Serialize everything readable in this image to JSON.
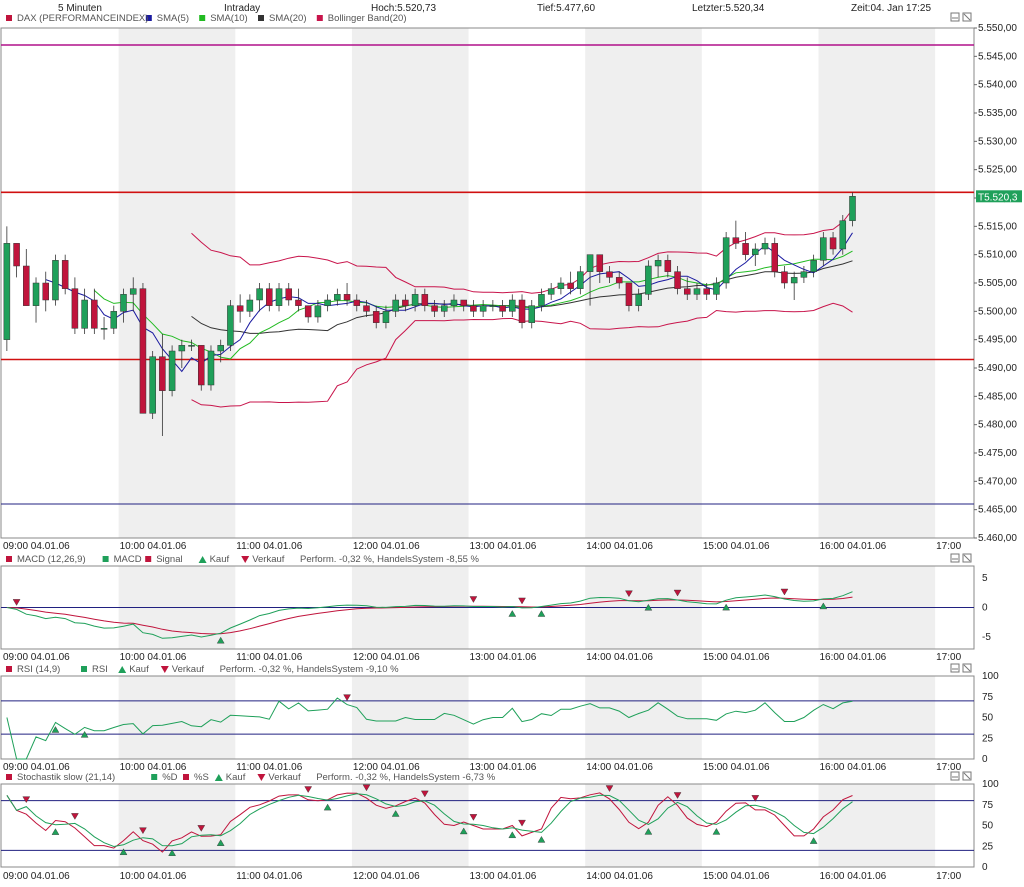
{
  "header": {
    "interval": "5 Minuten",
    "mode": "Intraday",
    "high": "Hoch:5.520,73",
    "low": "Tief:5.477,60",
    "last": "Letzter:5.520,34",
    "time": "Zeit:04. Jan 17:25"
  },
  "colors": {
    "up": "#1fa05a",
    "down": "#c0143c",
    "sma5": "#1a1aa0",
    "sma10": "#22bb22",
    "sma20": "#333333",
    "boll": "#c8144b",
    "redline": "#d01010",
    "magline": "#b0108a",
    "blueline": "#202080",
    "band": "#efefef",
    "border": "#888888",
    "tag": "#1fa05a"
  },
  "panels": [
    {
      "id": "price",
      "legend": [
        {
          "text": "DAX (PERFORMANCEINDEX)",
          "color": "#c0143c"
        },
        {
          "text": "SMA(5)",
          "color": "#1a1aa0"
        },
        {
          "text": "SMA(10)",
          "color": "#22bb22"
        },
        {
          "text": "SMA(20)",
          "color": "#333333"
        },
        {
          "text": "Bollinger Band(20)",
          "color": "#c8144b"
        }
      ],
      "yticks": [
        "5.550,00",
        "5.545,00",
        "5.540,00",
        "5.535,00",
        "5.530,00",
        "5.525,00",
        "5.520,00",
        "5.515,00",
        "5.510,00",
        "5.505,00",
        "5.500,00",
        "5.495,00",
        "5.490,00",
        "5.485,00",
        "5.480,00",
        "5.475,00",
        "5.470,00",
        "5.465,00",
        "5.460,00"
      ],
      "last_tag": "T5.520,3",
      "xticks": [
        "09:00 04.01.06",
        "10:00 04.01.06",
        "11:00 04.01.06",
        "12:00 04.01.06",
        "13:00 04.01.06",
        "14:00 04.01.06",
        "15:00 04.01.06",
        "16:00 04.01.06",
        "17:00"
      ]
    },
    {
      "id": "macd",
      "legend": [
        {
          "text": "MACD (12,26,9)",
          "color": "#c0143c"
        },
        {
          "text": "MACD",
          "color": "#1fa05a"
        },
        {
          "text": "Signal",
          "color": "#c0143c"
        },
        {
          "text": "Kauf",
          "color": "#1fa05a",
          "marker": "up"
        },
        {
          "text": "Verkauf",
          "color": "#c0143c",
          "marker": "down"
        },
        {
          "text": "Perform. -0,32 %, HandelsSystem -8,55 %",
          "color": ""
        }
      ],
      "yticks": [
        "5",
        "0",
        "-5"
      ],
      "xticks": [
        "09:00 04.01.06",
        "10:00 04.01.06",
        "11:00 04.01.06",
        "12:00 04.01.06",
        "13:00 04.01.06",
        "14:00 04.01.06",
        "15:00 04.01.06",
        "16:00 04.01.06",
        "17:00"
      ]
    },
    {
      "id": "rsi",
      "legend": [
        {
          "text": "RSI (14,9)",
          "color": "#c0143c"
        },
        {
          "text": "RSI",
          "color": "#1fa05a"
        },
        {
          "text": "Kauf",
          "color": "#1fa05a",
          "marker": "up"
        },
        {
          "text": "Verkauf",
          "color": "#c0143c",
          "marker": "down"
        },
        {
          "text": "Perform. -0,32 %, HandelsSystem -9,10 %",
          "color": ""
        }
      ],
      "yticks": [
        "100",
        "75",
        "50",
        "25",
        "0"
      ],
      "xticks": [
        "09:00 04.01.06",
        "10:00 04.01.06",
        "11:00 04.01.06",
        "12:00 04.01.06",
        "13:00 04.01.06",
        "14:00 04.01.06",
        "15:00 04.01.06",
        "16:00 04.01.06",
        "17:00"
      ]
    },
    {
      "id": "stoch",
      "legend": [
        {
          "text": "Stochastik slow (21,14)",
          "color": "#c0143c"
        },
        {
          "text": "%D",
          "color": "#1fa05a"
        },
        {
          "text": "%S",
          "color": "#c0143c"
        },
        {
          "text": "Kauf",
          "color": "#1fa05a",
          "marker": "up"
        },
        {
          "text": "Verkauf",
          "color": "#c0143c",
          "marker": "down"
        },
        {
          "text": "Perform. -0,32 %, HandelsSystem -6,73 %",
          "color": ""
        }
      ],
      "yticks": [
        "100",
        "75",
        "50",
        "25",
        "0"
      ],
      "xticks": [
        "09:00 04.01.06",
        "10:00 04.01.06",
        "11:00 04.01.06",
        "12:00 04.01.06",
        "13:00 04.01.06",
        "14:00 04.01.06",
        "15:00 04.01.06",
        "16:00 04.01.06",
        "17:00"
      ]
    }
  ],
  "chart_data": [
    {
      "type": "candlestick",
      "title": "DAX (PERFORMANCEINDEX)",
      "x_start": "09:00",
      "interval_minutes": 5,
      "ylim": [
        5460,
        5550
      ],
      "grid": false,
      "hlines": [
        {
          "value": 5547,
          "color": "#b0108a"
        },
        {
          "value": 5521,
          "color": "#d01010"
        },
        {
          "value": 5491.5,
          "color": "#d01010"
        },
        {
          "value": 5466,
          "color": "#202080"
        }
      ],
      "ohlc": [
        [
          5495.0,
          5515.0,
          5493.0,
          5512.0
        ],
        [
          5512.0,
          5512.0,
          5506.0,
          5508.0
        ],
        [
          5508.0,
          5511.0,
          5501.0,
          5501.0
        ],
        [
          5501.0,
          5506.0,
          5498.0,
          5505.0
        ],
        [
          5505.0,
          5507.0,
          5500.0,
          5502.0
        ],
        [
          5502.0,
          5510.0,
          5501.0,
          5509.0
        ],
        [
          5509.0,
          5510.0,
          5503.0,
          5504.0
        ],
        [
          5504.0,
          5506.0,
          5496.0,
          5497.0
        ],
        [
          5497.0,
          5504.0,
          5496.0,
          5502.0
        ],
        [
          5502.0,
          5504.0,
          5496.0,
          5497.0
        ],
        [
          5497.0,
          5499.0,
          5495.0,
          5497.0
        ],
        [
          5497.0,
          5501.0,
          5496.0,
          5500.0
        ],
        [
          5500.0,
          5504.0,
          5498.0,
          5503.0
        ],
        [
          5503.0,
          5506.0,
          5500.0,
          5504.0
        ],
        [
          5504.0,
          5505.0,
          5482.0,
          5482.0
        ],
        [
          5482.0,
          5493.0,
          5481.0,
          5492.0
        ],
        [
          5492.0,
          5496.0,
          5478.0,
          5486.0
        ],
        [
          5486.0,
          5494.0,
          5485.0,
          5493.0
        ],
        [
          5493.0,
          5495.0,
          5490.0,
          5494.0
        ],
        [
          5494.0,
          5495.0,
          5493.0,
          5494.0
        ],
        [
          5494.0,
          5494.0,
          5486.0,
          5487.0
        ],
        [
          5487.0,
          5494.0,
          5486.0,
          5493.0
        ],
        [
          5493.0,
          5495.0,
          5491.0,
          5494.0
        ],
        [
          5494.0,
          5502.0,
          5493.0,
          5501.0
        ],
        [
          5501.0,
          5503.0,
          5498.0,
          5500.0
        ],
        [
          5500.0,
          5503.0,
          5499.0,
          5502.0
        ],
        [
          5502.0,
          5505.0,
          5500.0,
          5504.0
        ],
        [
          5504.0,
          5505.0,
          5500.0,
          5501.0
        ],
        [
          5501.0,
          5505.0,
          5500.0,
          5504.0
        ],
        [
          5504.0,
          5505.0,
          5501.0,
          5502.0
        ],
        [
          5502.0,
          5504.0,
          5500.0,
          5501.0
        ],
        [
          5501.0,
          5501.0,
          5498.0,
          5499.0
        ],
        [
          5499.0,
          5502.0,
          5498.0,
          5501.0
        ],
        [
          5501.0,
          5503.0,
          5500.0,
          5502.0
        ],
        [
          5502.0,
          5504.0,
          5501.0,
          5503.0
        ],
        [
          5503.0,
          5505.0,
          5501.0,
          5502.0
        ],
        [
          5502.0,
          5503.0,
          5500.0,
          5501.0
        ],
        [
          5501.0,
          5502.0,
          5499.0,
          5500.0
        ],
        [
          5500.0,
          5501.0,
          5497.0,
          5498.0
        ],
        [
          5498.0,
          5501.0,
          5497.0,
          5500.0
        ],
        [
          5500.0,
          5503.0,
          5499.0,
          5502.0
        ],
        [
          5502.0,
          5503.0,
          5500.0,
          5501.0
        ],
        [
          5501.0,
          5504.0,
          5500.0,
          5503.0
        ],
        [
          5503.0,
          5504.0,
          5500.0,
          5501.0
        ],
        [
          5501.0,
          5502.0,
          5499.0,
          5500.0
        ],
        [
          5500.0,
          5502.0,
          5499.0,
          5501.0
        ],
        [
          5501.0,
          5503.0,
          5500.0,
          5502.0
        ],
        [
          5502.0,
          5502.0,
          5500.0,
          5501.0
        ],
        [
          5501.0,
          5502.0,
          5499.0,
          5500.0
        ],
        [
          5500.0,
          5502.0,
          5499.0,
          5501.0
        ],
        [
          5501.0,
          5502.0,
          5500.0,
          5501.0
        ],
        [
          5501.0,
          5502.0,
          5499.0,
          5500.0
        ],
        [
          5500.0,
          5503.0,
          5499.0,
          5502.0
        ],
        [
          5502.0,
          5503.0,
          5497.0,
          5498.0
        ],
        [
          5498.0,
          5502.0,
          5497.0,
          5501.0
        ],
        [
          5501.0,
          5504.0,
          5500.0,
          5503.0
        ],
        [
          5503.0,
          5505.0,
          5502.0,
          5504.0
        ],
        [
          5504.0,
          5506.0,
          5503.0,
          5505.0
        ],
        [
          5505.0,
          5507.0,
          5503.0,
          5504.0
        ],
        [
          5504.0,
          5508.0,
          5503.0,
          5507.0
        ],
        [
          5507.0,
          5510.0,
          5501.0,
          5510.0
        ],
        [
          5510.0,
          5510.0,
          5505.0,
          5507.0
        ],
        [
          5507.0,
          5508.0,
          5505.0,
          5506.0
        ],
        [
          5506.0,
          5507.0,
          5504.0,
          5505.0
        ],
        [
          5505.0,
          5505.0,
          5500.0,
          5501.0
        ],
        [
          5501.0,
          5504.0,
          5500.0,
          5503.0
        ],
        [
          5503.0,
          5509.0,
          5502.0,
          5508.0
        ],
        [
          5508.0,
          5510.0,
          5506.0,
          5509.0
        ],
        [
          5509.0,
          5510.0,
          5506.0,
          5507.0
        ],
        [
          5507.0,
          5508.0,
          5503.0,
          5504.0
        ],
        [
          5504.0,
          5506.0,
          5502.0,
          5503.0
        ],
        [
          5503.0,
          5505.0,
          5502.0,
          5504.0
        ],
        [
          5504.0,
          5505.0,
          5502.0,
          5503.0
        ],
        [
          5503.0,
          5506.0,
          5502.0,
          5505.0
        ],
        [
          5505.0,
          5514.0,
          5504.0,
          5513.0
        ],
        [
          5513.0,
          5516.0,
          5511.0,
          5512.0
        ],
        [
          5512.0,
          5514.0,
          5509.0,
          5510.0
        ],
        [
          5510.0,
          5512.0,
          5508.0,
          5511.0
        ],
        [
          5511.0,
          5513.0,
          5510.0,
          5512.0
        ],
        [
          5512.0,
          5513.0,
          5506.0,
          5507.0
        ],
        [
          5507.0,
          5508.0,
          5504.0,
          5505.0
        ],
        [
          5505.0,
          5507.0,
          5502.0,
          5506.0
        ],
        [
          5506.0,
          5508.0,
          5505.0,
          5507.0
        ],
        [
          5507.0,
          5510.0,
          5506.0,
          5509.0
        ],
        [
          5509.0,
          5514.0,
          5508.0,
          5513.0
        ],
        [
          5513.0,
          5514.0,
          5510.0,
          5511.0
        ],
        [
          5511.0,
          5517.0,
          5510.0,
          5516.0
        ],
        [
          5516.0,
          5521.0,
          5515.0,
          5520.3
        ]
      ]
    },
    {
      "type": "line",
      "title": "MACD (12,26,9)",
      "ylim": [
        -7,
        7
      ],
      "series": [
        {
          "name": "MACD"
        },
        {
          "name": "Signal"
        }
      ],
      "hlines": [
        0
      ]
    },
    {
      "type": "line",
      "title": "RSI (14,9)",
      "ylim": [
        0,
        100
      ],
      "series": [
        {
          "name": "RSI"
        }
      ],
      "hlines": [
        70,
        30
      ]
    },
    {
      "type": "line",
      "title": "Stochastik slow (21,14)",
      "ylim": [
        0,
        100
      ],
      "series": [
        {
          "name": "%D"
        },
        {
          "name": "%S"
        }
      ],
      "hlines": [
        80,
        20
      ]
    }
  ]
}
